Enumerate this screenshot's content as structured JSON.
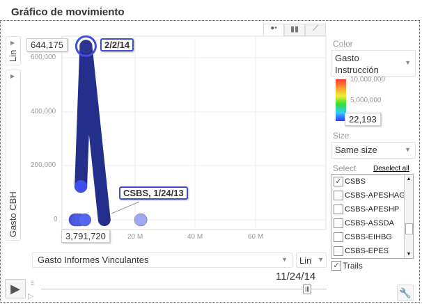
{
  "title": "Gráfico de movimiento",
  "y_axis": {
    "scale": "Lin",
    "label": "Gasto CBH",
    "ticks": [
      "600,000",
      "400,000",
      "200,000",
      "0"
    ]
  },
  "x_axis": {
    "label": "Gasto Informes Vinculantes",
    "scale": "Lin",
    "ticks": [
      "20 M",
      "40 M",
      "60 M"
    ]
  },
  "hover": {
    "y_value": "644,175",
    "x_value": "3,791,720",
    "date": "2/2/14"
  },
  "trail_label": "CSBS, 1/24/13",
  "color": {
    "label": "Color",
    "value": "Gasto Instrucción",
    "max": "10,000,000",
    "mid": "5,000,000",
    "current": "22,193"
  },
  "size": {
    "label": "Size",
    "value": "Same size"
  },
  "select": {
    "label": "Select",
    "deselect": "Deselect all",
    "items": [
      {
        "name": "CSBS",
        "checked": true
      },
      {
        "name": "CSBS-APESHAG",
        "checked": false
      },
      {
        "name": "CSBS-APESHP",
        "checked": false
      },
      {
        "name": "CSBS-ASSDA",
        "checked": false
      },
      {
        "name": "CSBS-EIHBG",
        "checked": false
      },
      {
        "name": "CSBS-EPES",
        "checked": false
      }
    ]
  },
  "trails": {
    "label": "Trails",
    "checked": true
  },
  "time": {
    "date": "11/24/14",
    "progress": 0.93
  },
  "chart_data": {
    "type": "scatter",
    "xlim": [
      0,
      83500000
    ],
    "ylim": [
      -40000,
      680000
    ],
    "trail": [
      [
        2100000,
        124000
      ],
      [
        3791720,
        644175
      ],
      [
        9900000,
        0
      ]
    ],
    "bubbles": [
      {
        "x": 2100000,
        "y": 124000,
        "c": "#3c50f0"
      },
      {
        "x": 3791720,
        "y": 644175,
        "c": "#2a3590"
      },
      {
        "x": 200000,
        "y": 0,
        "c": "#3c50f0"
      },
      {
        "x": 1000000,
        "y": 0,
        "c": "#4a5cf0"
      },
      {
        "x": 1800000,
        "y": 0,
        "c": "#4a5cf0"
      },
      {
        "x": 3400000,
        "y": 0,
        "c": "#5566f0"
      },
      {
        "x": 22000000,
        "y": 0,
        "c": "#a0a8f4"
      }
    ]
  }
}
